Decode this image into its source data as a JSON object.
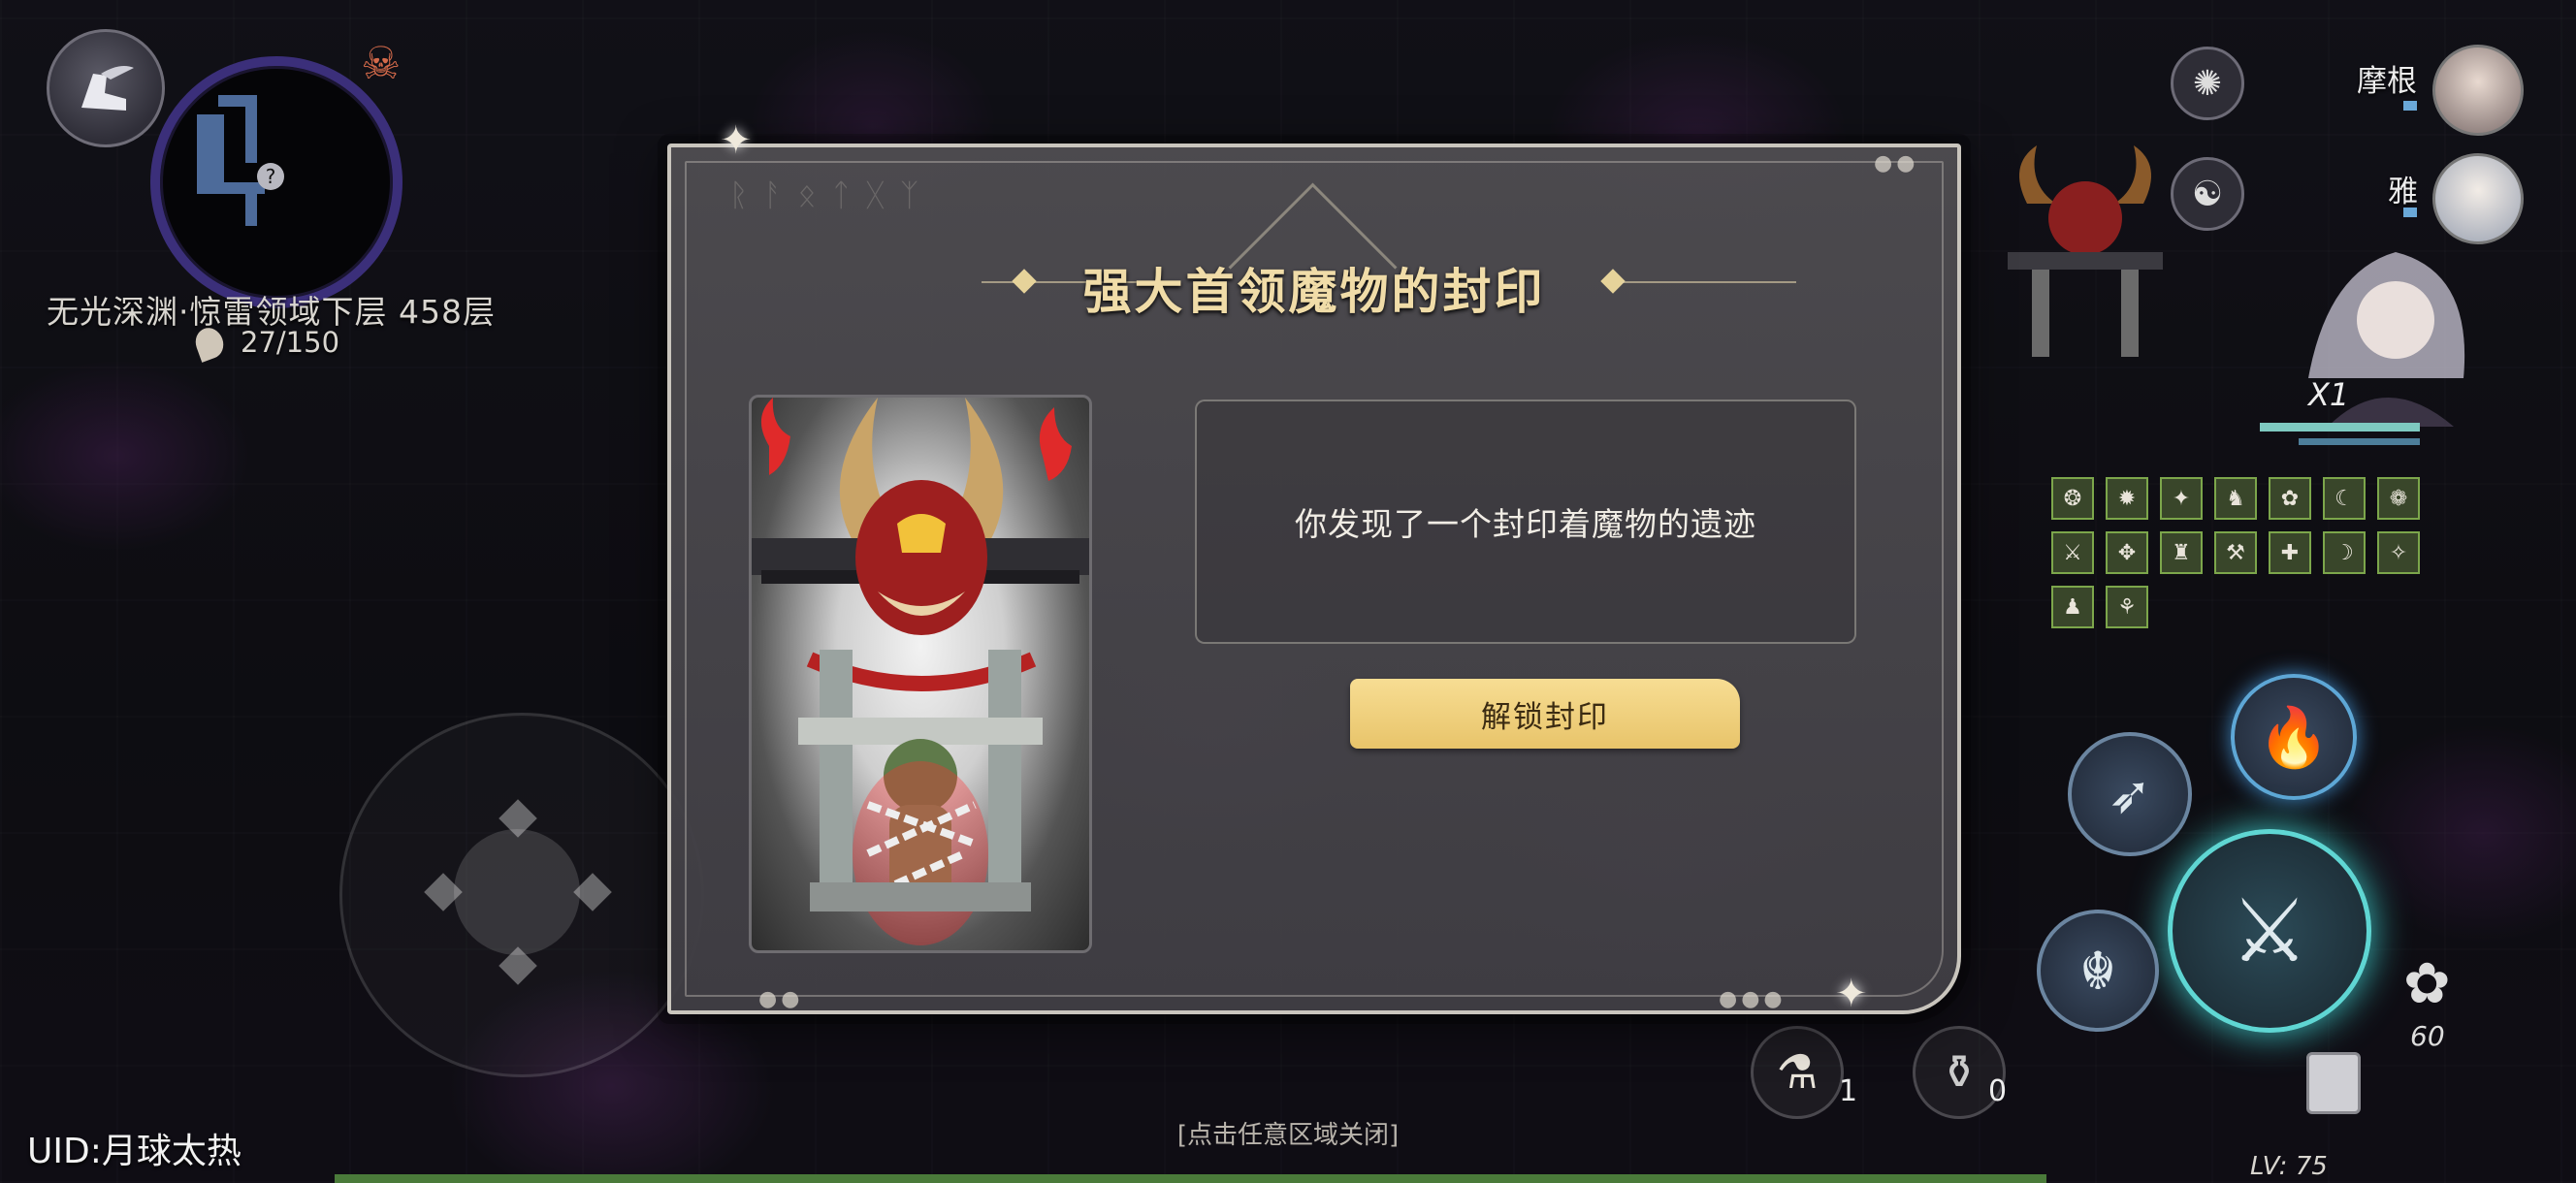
{
  "hud": {
    "floor_name": "无光深渊·惊雷领域下层 458层",
    "stamina": "27/150",
    "uid": "UID:月球太热",
    "close_hint": "[点击任意区域关闭]",
    "level": "LV: 75",
    "minimap_marker": "?"
  },
  "party": [
    {
      "name": "摩根"
    },
    {
      "name": "雅"
    }
  ],
  "combat": {
    "multiplier": "X1",
    "pet_count": "60"
  },
  "potions": [
    {
      "icon": "red-potion-icon",
      "count": "1"
    },
    {
      "icon": "empty-potion-icon",
      "count": "0"
    }
  ],
  "dialog": {
    "title": "强大首领魔物的封印",
    "message": "你发现了一个封印着魔物的遗迹",
    "unlock_label": "解锁封印"
  },
  "colors": {
    "accent_gold": "#f0dca8",
    "button_gold": "#f0d17f",
    "skill_glow": "#5fd6d3",
    "minimap_ring": "#3b2f7a"
  }
}
